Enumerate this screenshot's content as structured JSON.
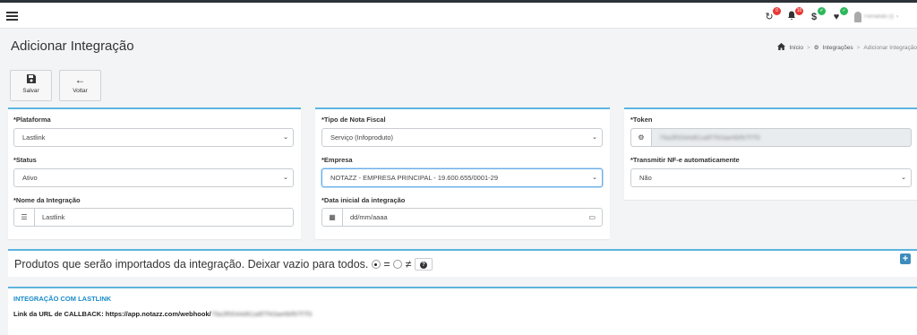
{
  "topbar": {
    "refresh_badge": "0",
    "bell_badge": "10",
    "dollar_badge": "✓",
    "heart_badge": "✓",
    "user_name": "Fernando (I)"
  },
  "header": {
    "title": "Adicionar Integração",
    "breadcrumb": [
      "Início",
      "Integrações",
      "Adicionar Integração"
    ]
  },
  "toolbar": {
    "save_label": "Salvar",
    "back_label": "Voltar"
  },
  "form": {
    "plataforma": {
      "label": "*Plataforma",
      "value": "Lastlink"
    },
    "status": {
      "label": "*Status",
      "value": "Ativo"
    },
    "nome": {
      "label": "*Nome da Integração",
      "value": "Lastlink"
    },
    "tipo_nota": {
      "label": "*Tipo de Nota Fiscal",
      "value": "Serviço (Infoproduto)"
    },
    "empresa": {
      "label": "*Empresa",
      "value": "NOTAZZ - EMPRESA PRINCIPAL - 19.600.655/0001-29"
    },
    "data_inicial": {
      "label": "*Data inicial da integração",
      "placeholder": "dd/mm/aaaa"
    },
    "token": {
      "label": "*Token",
      "value": "79a3f0044d61a8f7f43ae6bf97f7f3"
    },
    "transmitir": {
      "label": "*Transmitir NF-e automaticamente",
      "value": "Não"
    }
  },
  "produtos": {
    "text": "Produtos que serão importados da integração. Deixar vazio para todos.",
    "equal_symbol": "=",
    "notequal_symbol": "≠",
    "help_symbol": "?",
    "add_symbol": "+"
  },
  "integracao": {
    "title": "INTEGRAÇÃO COM LASTLINK",
    "callback_label": "Link da URL de CALLBACK: https://app.notazz.com/webhook/",
    "callback_token": "79a3f0044d61a8f7f43ae6bf97f7f3"
  },
  "colors": {
    "accent": "#5db4de",
    "link": "#1a8bc9",
    "badge_red": "#e53935",
    "badge_green": "#2eb85c",
    "add_button": "#3c8dbc"
  }
}
